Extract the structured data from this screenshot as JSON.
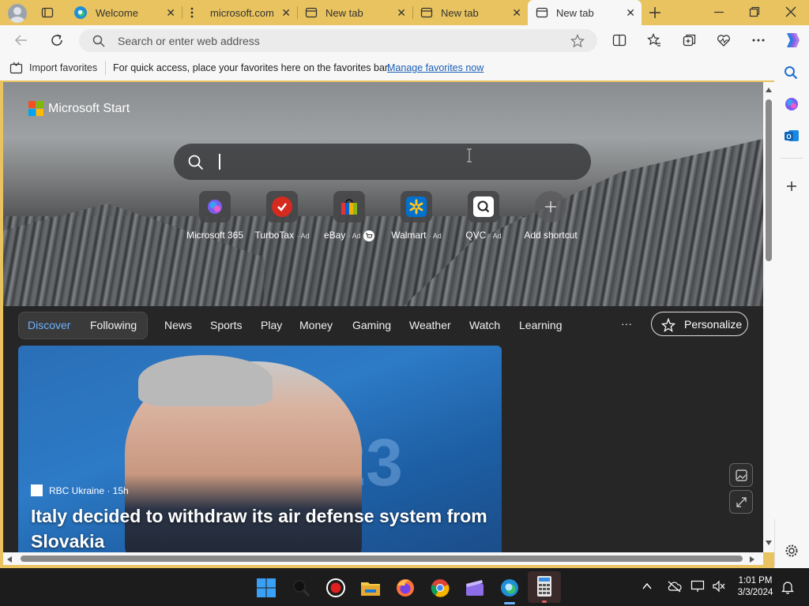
{
  "tabs": [
    {
      "title": "Welcome",
      "close": "✕"
    },
    {
      "title": "microsoft.com/",
      "close": "✕"
    },
    {
      "title": "New tab",
      "close": "✕"
    },
    {
      "title": "New tab",
      "close": "✕"
    },
    {
      "title": "New tab",
      "close": "✕",
      "active": true
    }
  ],
  "address_bar": {
    "placeholder": "Search or enter web address"
  },
  "favorites_bar": {
    "import_label": "Import favorites",
    "hint": "For quick access, place your favorites here on the favorites bar.",
    "manage_link": "Manage favorites now"
  },
  "hero": {
    "brand": "Microsoft Start",
    "quick_links": [
      {
        "label": "Microsoft 365",
        "ad": ""
      },
      {
        "label": "TurboTax",
        "ad": "· Ad"
      },
      {
        "label": "eBay",
        "ad": "· Ad"
      },
      {
        "label": "Walmart",
        "ad": "· Ad"
      },
      {
        "label": "QVC",
        "ad": "· Ad"
      },
      {
        "label": "Add shortcut",
        "ad": ""
      }
    ]
  },
  "feed_nav": {
    "items": [
      "Discover",
      "Following",
      "News",
      "Sports",
      "Play",
      "Money",
      "Gaming",
      "Weather",
      "Watch",
      "Learning"
    ],
    "more": "···",
    "personalize": "Personalize",
    "active": "Discover"
  },
  "news_card": {
    "source": "RBC Ukraine · 15h",
    "headline": "Italy decided to withdraw its air defense system from Slovakia",
    "background_text": "2023"
  },
  "taskbar": {
    "time": "1:01 PM",
    "date": "3/3/2024"
  },
  "colors": {
    "tabstrip": "#e9c35f",
    "accent_link": "#1a5fb4",
    "taskbar": "#1c1c1c",
    "feed_bg": "#262626"
  }
}
